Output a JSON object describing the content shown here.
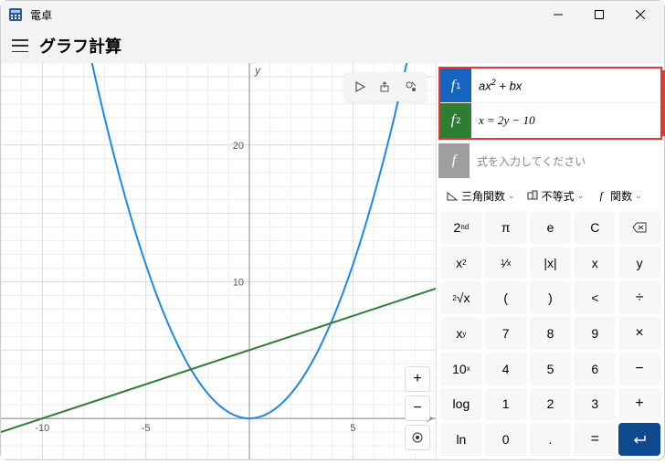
{
  "window": {
    "title": "電卓"
  },
  "mode": "グラフ計算",
  "equations": [
    {
      "badge": "f",
      "sub": "1",
      "latex": "ax² + bx",
      "color": "#1565c0"
    },
    {
      "badge": "f",
      "sub": "2",
      "latex": "x = 2y − 10",
      "color": "#2e7d32"
    }
  ],
  "eq_placeholder": "式を入力してください",
  "axis_y_label": "y",
  "chart_data": {
    "type": "line",
    "xlim": [
      -12,
      9
    ],
    "ylim": [
      -3,
      26
    ],
    "xticks": [
      -10,
      -5,
      0,
      5
    ],
    "yticks": [
      10,
      20
    ],
    "series": [
      {
        "name": "f1",
        "color": "#1e88e5",
        "formula": "y = x^2 * 0.45",
        "x": [
          -9,
          -8,
          -7,
          -6,
          -5,
          -4,
          -3,
          -2,
          -1,
          0,
          1,
          2,
          3,
          4,
          5,
          6,
          7,
          8,
          9
        ]
      },
      {
        "name": "f2",
        "color": "#2e7d32",
        "formula": "y = (x+10)/2",
        "x": [
          -12,
          9
        ]
      }
    ]
  },
  "dropdowns": {
    "trig": "三角関数",
    "ineq": "不等式",
    "fn": "関数"
  },
  "keypad": [
    [
      "2ⁿᵈ",
      "π",
      "e",
      "C",
      "⌫"
    ],
    [
      "x²",
      "¹⁄ₓ",
      "|x|",
      "x",
      "y"
    ],
    [
      "²√x",
      "(",
      ")",
      "<",
      "÷"
    ],
    [
      "xʸ",
      "7",
      "8",
      "9",
      "×"
    ],
    [
      "10ˣ",
      "4",
      "5",
      "6",
      "−"
    ],
    [
      "log",
      "1",
      "2",
      "3",
      "+"
    ],
    [
      "ln",
      "0",
      ".",
      "=",
      "↵"
    ]
  ],
  "zoom": {
    "in": "+",
    "out": "−"
  }
}
